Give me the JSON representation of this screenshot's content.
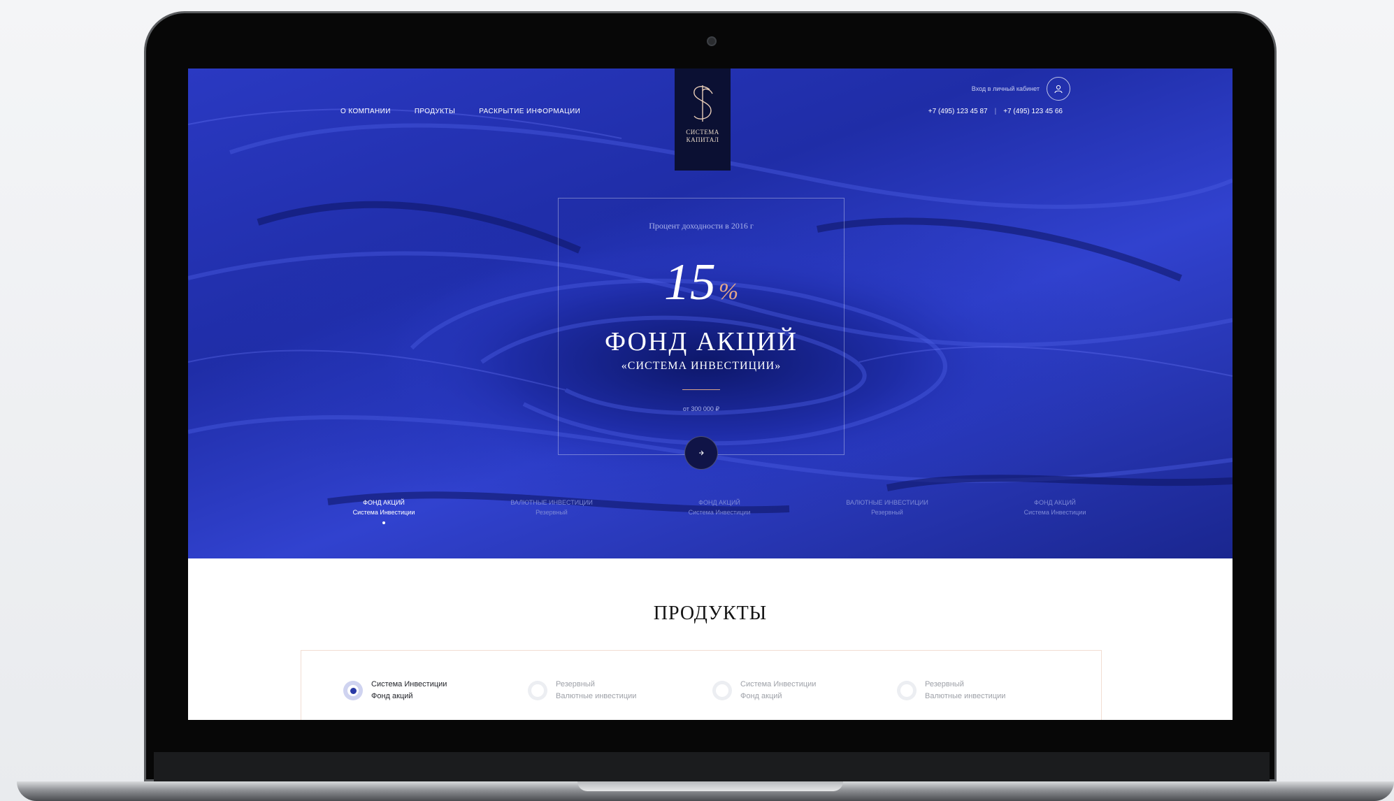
{
  "nav": {
    "items": [
      "О компании",
      "Продукты",
      "Раскрытие информации"
    ]
  },
  "logo": {
    "line1": "СИСТЕМА",
    "line2": "КАПИТАЛ"
  },
  "header": {
    "login_text": "Вход в личный кабинет",
    "phone1": "+7 (495) 123 45 87",
    "phone_separator": "|",
    "phone2": "+7 (495) 123 45 66"
  },
  "hero": {
    "caption": "Процент доходности в 2016 г",
    "percent_value": "15",
    "percent_sign": "%",
    "title": "ФОНД АКЦИЙ",
    "subtitle": "«СИСТЕМА ИНВЕСТИЦИИ»",
    "price": "от 300 000 ₽"
  },
  "slider": {
    "tabs": [
      {
        "line1": "Фонд акций",
        "line2": "Система Инвестиции",
        "active": true
      },
      {
        "line1": "Валютные инвестиции",
        "line2": "Резервный",
        "active": false
      },
      {
        "line1": "Фонд акций",
        "line2": "Система Инвестиции",
        "active": false
      },
      {
        "line1": "Валютные инвестиции",
        "line2": "Резервный",
        "active": false
      },
      {
        "line1": "Фонд акций",
        "line2": "Система Инвестиции",
        "active": false
      }
    ]
  },
  "products": {
    "title": "ПРОДУКТЫ",
    "items": [
      {
        "line1": "Система Инвестиции",
        "line2": "Фонд акций",
        "active": true
      },
      {
        "line1": "Резервный",
        "line2": "Валютные инвестиции",
        "active": false
      },
      {
        "line1": "Система Инвестиции",
        "line2": "Фонд акций",
        "active": false
      },
      {
        "line1": "Резервный",
        "line2": "Валютные инвестиции",
        "active": false
      }
    ]
  },
  "colors": {
    "hero_blue": "#2233b8",
    "logo_bg": "#0b1033",
    "accent_copper": "#e4a88a"
  }
}
